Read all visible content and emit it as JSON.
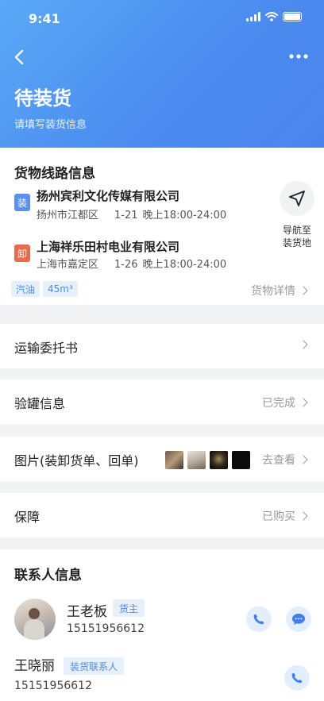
{
  "status_bar": {
    "time": "9:41"
  },
  "header": {
    "title": "待装货",
    "subtitle": "请填写装货信息"
  },
  "route": {
    "title": "货物线路信息",
    "load": {
      "tag": "装",
      "tag_color": "#5b8ff0",
      "company": "扬州宾利文化传媒有限公司",
      "address": "扬州市江都区",
      "date": "1-21",
      "time": "晚上18:00-24:00"
    },
    "unload": {
      "tag": "卸",
      "tag_color": "#ea6a4c",
      "company": "上海祥乐田村电业有限公司",
      "address": "上海市嘉定区",
      "date": "1-26",
      "time": "晚上18:00-24:00"
    },
    "nav_label_1": "导航至",
    "nav_label_2": "装货地",
    "chips": [
      "汽油",
      "45m³"
    ],
    "detail_link": "货物详情"
  },
  "rows": {
    "contract": {
      "label": "运输委托书"
    },
    "inspection": {
      "label": "验罐信息",
      "status": "已完成"
    },
    "images": {
      "label": "图片(装卸货单、回单)",
      "action": "去查看"
    },
    "insurance": {
      "label": "保障",
      "status": "已购买"
    }
  },
  "contacts": {
    "title": "联系人信息",
    "items": [
      {
        "name": "王老板",
        "role": "货主",
        "phone": "15151956612"
      },
      {
        "name": "王晓丽",
        "role": "装货联系人",
        "phone": "15151956612"
      }
    ]
  },
  "colors": {
    "accent": "#4a8bef",
    "header_start": "#5aa8f6"
  },
  "icons": [
    "back-icon",
    "more-icon",
    "navigation-icon",
    "chevron-right-icon",
    "phone-icon",
    "chat-icon"
  ]
}
